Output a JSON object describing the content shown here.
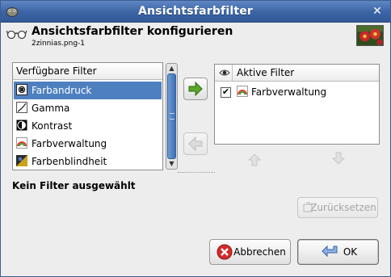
{
  "window": {
    "title": "Ansichtsfarbfilter"
  },
  "header": {
    "title": "Ansichtsfarbfilter konfigurieren",
    "subtitle": "2zinnias.png-1"
  },
  "available": {
    "column_header": "Verfügbare Filter",
    "items": [
      {
        "label": "Farbandruck",
        "icon": "color-proof-icon",
        "selected": true
      },
      {
        "label": "Gamma",
        "icon": "gamma-icon",
        "selected": false
      },
      {
        "label": "Kontrast",
        "icon": "contrast-icon",
        "selected": false
      },
      {
        "label": "Farbverwaltung",
        "icon": "color-management-icon",
        "selected": false
      },
      {
        "label": "Farbenblindheit",
        "icon": "color-deficiency-icon",
        "selected": false
      }
    ]
  },
  "active": {
    "column_header": "Aktive Filter",
    "items": [
      {
        "label": "Farbverwaltung",
        "checked": true,
        "icon": "color-management-icon"
      }
    ]
  },
  "status_text": "Kein Filter ausgewählt",
  "buttons": {
    "reset": "Zurücksetzen",
    "cancel": "Abbrechen",
    "ok": "OK"
  },
  "colors": {
    "titlebar": "#3c64a4",
    "selection": "#4e80c0",
    "add_arrow": "#4e9a1e",
    "cancel_red": "#d22c2c"
  }
}
